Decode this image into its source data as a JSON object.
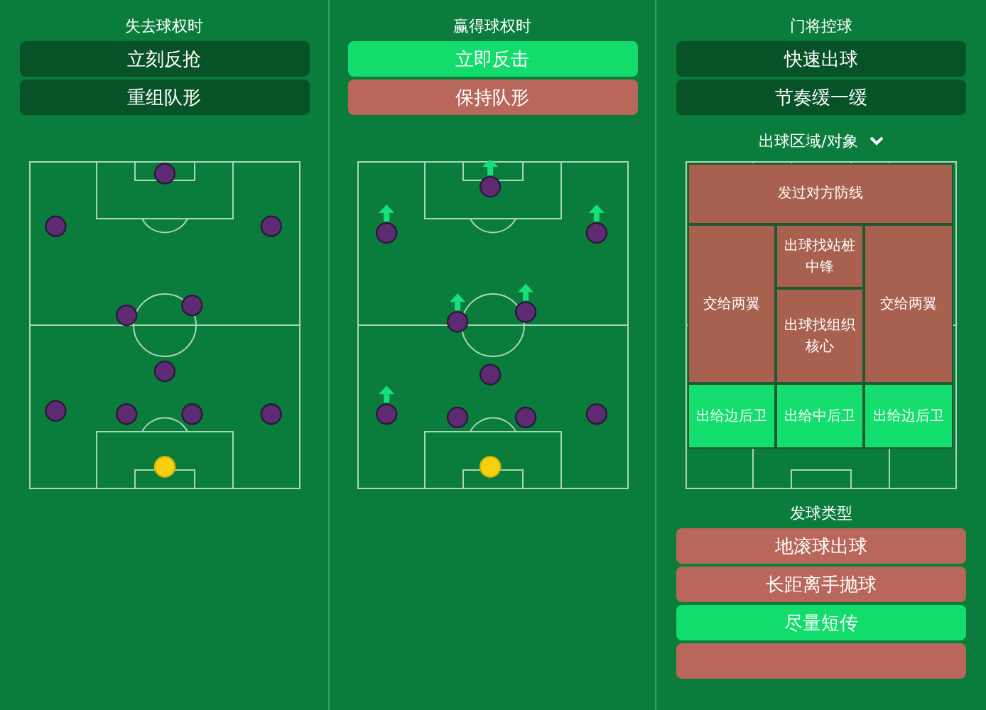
{
  "columns": [
    {
      "title": "失去球权时",
      "buttons": [
        {
          "label": "立刻反抢",
          "kind": "neutral"
        },
        {
          "label": "重组队形",
          "kind": "neutral"
        }
      ],
      "pitch": {
        "players": [
          {
            "kind": "outfield",
            "arrow": false
          },
          {
            "kind": "outfield",
            "arrow": false
          },
          {
            "kind": "outfield",
            "arrow": false
          },
          {
            "kind": "outfield",
            "arrow": false
          },
          {
            "kind": "outfield",
            "arrow": false
          },
          {
            "kind": "outfield",
            "arrow": false
          },
          {
            "kind": "outfield",
            "arrow": false
          },
          {
            "kind": "outfield",
            "arrow": false
          },
          {
            "kind": "outfield",
            "arrow": false
          },
          {
            "kind": "outfield",
            "arrow": false
          },
          {
            "kind": "goalkeeper",
            "arrow": false
          }
        ]
      }
    },
    {
      "title": "赢得球权时",
      "buttons": [
        {
          "label": "立即反击",
          "kind": "on"
        },
        {
          "label": "保持队形",
          "kind": "off"
        }
      ],
      "pitch": {
        "players": [
          {
            "kind": "outfield",
            "arrow": true
          },
          {
            "kind": "outfield",
            "arrow": true
          },
          {
            "kind": "outfield",
            "arrow": true
          },
          {
            "kind": "outfield",
            "arrow": true
          },
          {
            "kind": "outfield",
            "arrow": true
          },
          {
            "kind": "outfield",
            "arrow": false
          },
          {
            "kind": "outfield",
            "arrow": true
          },
          {
            "kind": "outfield",
            "arrow": false
          },
          {
            "kind": "outfield",
            "arrow": false
          },
          {
            "kind": "outfield",
            "arrow": false
          },
          {
            "kind": "goalkeeper",
            "arrow": false
          }
        ]
      }
    },
    {
      "title": "门将控球",
      "buttons": [
        {
          "label": "快速出球",
          "kind": "neutral"
        },
        {
          "label": "节奏缓一缓",
          "kind": "neutral"
        }
      ],
      "zones_title": "出球区域/对象",
      "zones": [
        {
          "label": "发过对方防线",
          "kind": "off"
        },
        {
          "label": "交给两翼",
          "kind": "off"
        },
        {
          "label": "出球找站桩中锋",
          "kind": "off"
        },
        {
          "label": "交给两翼",
          "kind": "off"
        },
        {
          "label": "出球找组织核心",
          "kind": "off"
        },
        {
          "label": "出给边后卫",
          "kind": "on"
        },
        {
          "label": "出给中后卫",
          "kind": "on"
        },
        {
          "label": "出给边后卫",
          "kind": "on"
        }
      ],
      "distribution_title": "发球类型",
      "distribution": [
        {
          "label": "地滚球出球",
          "kind": "off"
        },
        {
          "label": "长距离手抛球",
          "kind": "off"
        },
        {
          "label": "尽量短传",
          "kind": "on"
        },
        {
          "kind": "off"
        }
      ]
    }
  ]
}
